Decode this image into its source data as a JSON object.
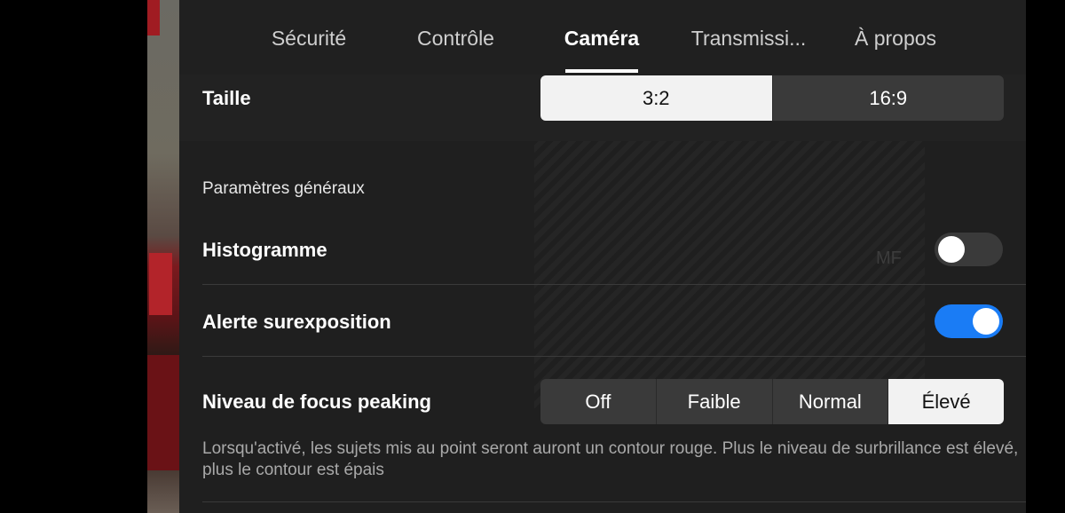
{
  "tabs": [
    {
      "label": "Sécurité",
      "active": false
    },
    {
      "label": "Contrôle",
      "active": false
    },
    {
      "label": "Caméra",
      "active": true
    },
    {
      "label": "Transmissi...",
      "active": false
    },
    {
      "label": "À propos",
      "active": false
    }
  ],
  "overlay_text": "MF",
  "size": {
    "label": "Taille",
    "options": [
      "3:2",
      "16:9"
    ],
    "selected": "3:2"
  },
  "general": {
    "section_label": "Paramètres généraux",
    "histogram": {
      "label": "Histogramme",
      "enabled": false
    },
    "overexposure": {
      "label": "Alerte surexposition",
      "enabled": true
    },
    "focus_peaking": {
      "label": "Niveau de focus peaking",
      "options": [
        "Off",
        "Faible",
        "Normal",
        "Élevé"
      ],
      "selected": "Élevé",
      "description": "Lorsqu'activé, les sujets mis au point seront auront un contour rouge. Plus le niveau de surbrillance est élevé, plus le contour est épais"
    }
  },
  "colors": {
    "panel_bg": "#1f1f1f",
    "toggle_on": "#1a7cf5",
    "toggle_off": "#3a3a3a",
    "selected_segment": "#f2f2f2"
  }
}
